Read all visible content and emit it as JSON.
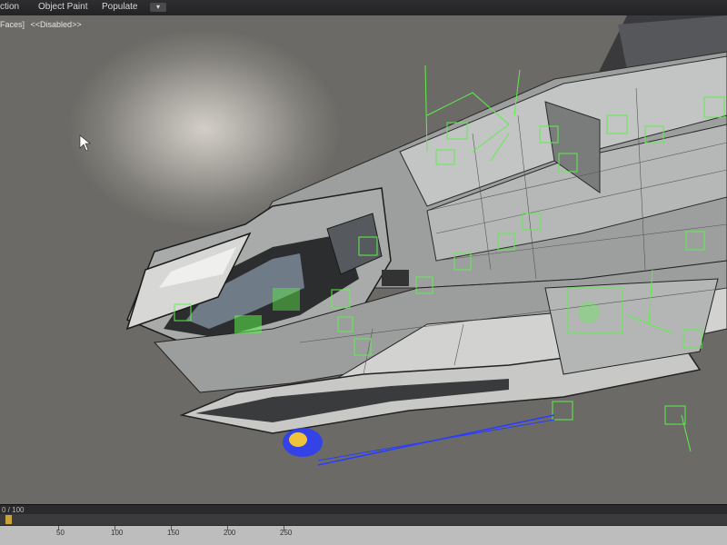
{
  "ribbon": {
    "tabs": [
      {
        "label": "ction"
      },
      {
        "label": "Object Paint"
      },
      {
        "label": "Populate"
      }
    ],
    "options_glyph": "▾"
  },
  "viewport": {
    "label_left": "Faces]",
    "label_right": "<<Disabled>>"
  },
  "timeline": {
    "counter": "0 / 100",
    "ruler_labels": [
      "50",
      "100",
      "150",
      "200",
      "250"
    ]
  },
  "colors": {
    "helper_green": "#5cf04a",
    "selection_blue": "#2a3cff",
    "gizmo_yellow": "#f0c43a"
  }
}
